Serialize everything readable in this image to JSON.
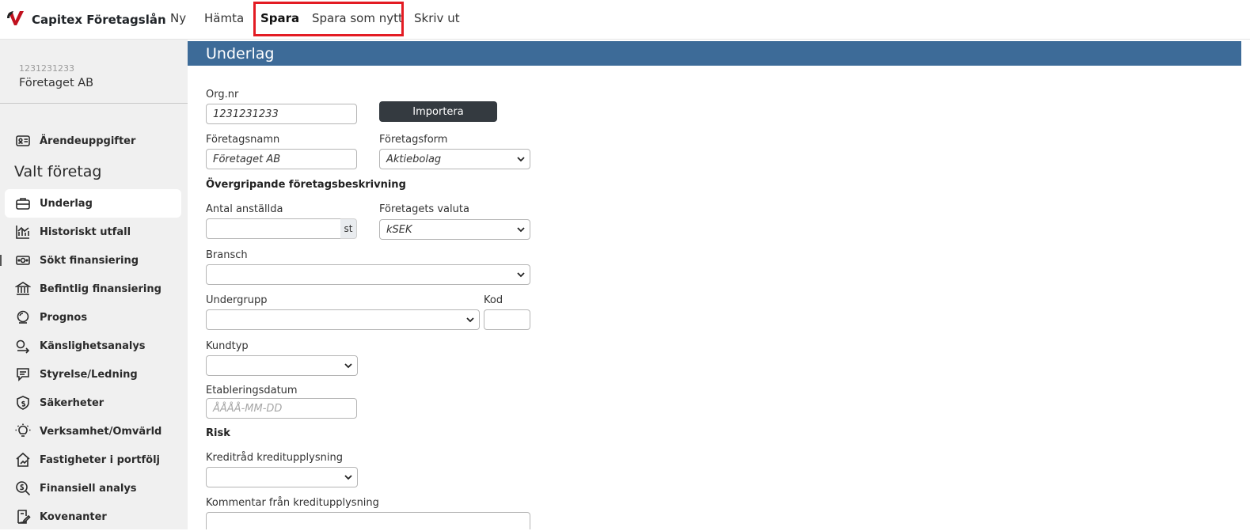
{
  "topbar": {
    "brand": "Capitex Företagslån",
    "nav": [
      "Ny",
      "Hämta",
      "Spara",
      "Spara som nytt",
      "Skriv ut"
    ]
  },
  "sidebar": {
    "company_orgnr": "1231231233",
    "company_name": "Företaget AB",
    "case_item": "Ärendeuppgifter",
    "section_title": "Valt företag",
    "items": [
      "Underlag",
      "Historiskt utfall",
      "Sökt finansiering",
      "Befintlig finansiering",
      "Prognos",
      "Känslighetsanalys",
      "Styrelse/Ledning",
      "Säkerheter",
      "Verksamhet/Omvärld",
      "Fastigheter i portfölj",
      "Finansiell analys",
      "Kovenanter"
    ],
    "active_item": "Underlag"
  },
  "content": {
    "title": "Underlag",
    "orgnr_label": "Org.nr",
    "orgnr_value": "1231231233",
    "import_button": "Importera",
    "company_name_label": "Företagsnamn",
    "company_name_value": "Företaget AB",
    "company_form_label": "Företagsform",
    "company_form_value": "Aktiebolag",
    "overview_heading": "Övergripande företagsbeskrivning",
    "employees_label": "Antal anställda",
    "employees_value": "",
    "employees_unit": "st",
    "currency_label": "Företagets valuta",
    "currency_value": "kSEK",
    "industry_label": "Bransch",
    "industry_value": "",
    "subgroup_label": "Undergrupp",
    "subgroup_value": "",
    "code_label": "Kod",
    "code_value": "",
    "customer_type_label": "Kundtyp",
    "customer_type_value": "",
    "established_label": "Etableringsdatum",
    "established_placeholder": "ÅÅÅÅ-MM-DD",
    "risk_heading": "Risk",
    "credit_advice_label": "Kreditråd kreditupplysning",
    "credit_advice_value": "",
    "credit_comment_label": "Kommentar från kreditupplysning"
  },
  "colors": {
    "header_bar": "#3d6b98",
    "highlight": "#e31b23",
    "sidebar_bg": "#f0f0f0",
    "button_dark": "#343a40"
  }
}
